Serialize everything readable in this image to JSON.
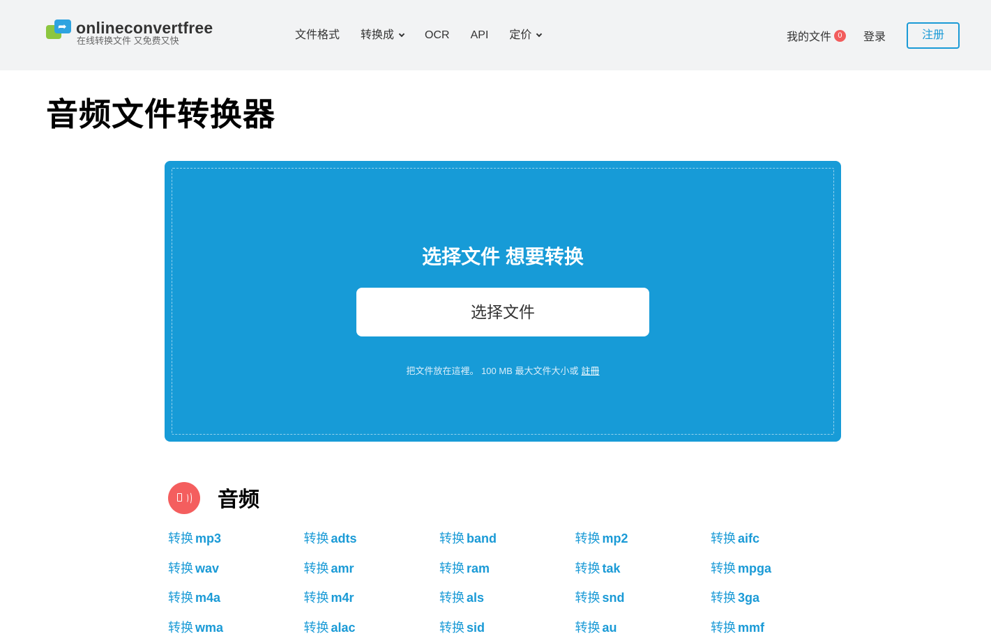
{
  "header": {
    "logo_name": "onlineconvertfree",
    "logo_tagline": "在线转换文件 又免费又快",
    "nav": [
      {
        "label": "文件格式",
        "dropdown": false
      },
      {
        "label": "转换成",
        "dropdown": true
      },
      {
        "label": "OCR",
        "dropdown": false
      },
      {
        "label": "API",
        "dropdown": false
      },
      {
        "label": "定价",
        "dropdown": true
      }
    ],
    "my_files_label": "我的文件",
    "my_files_count": "0",
    "login_label": "登录",
    "register_label": "注册"
  },
  "page_title": "音频文件转换器",
  "upload": {
    "heading": "选择文件 想要转换",
    "button_label": "选择文件",
    "note": "把文件放在這裡。 100 MB 最大文件大小或",
    "note_link": "註冊"
  },
  "audio_section": {
    "title": "音频",
    "icon": "speaker-icon",
    "convert_prefix": "转换",
    "formats": [
      "mp3",
      "adts",
      "band",
      "mp2",
      "aifc",
      "wav",
      "amr",
      "ram",
      "tak",
      "mpga",
      "m4a",
      "m4r",
      "als",
      "snd",
      "3ga",
      "wma",
      "alac",
      "sid",
      "au",
      "mmf"
    ]
  },
  "colors": {
    "accent": "#179bd7",
    "badge": "#f25c5c",
    "header_bg": "#f2f3f4",
    "section_icon": "#f45e5e"
  }
}
